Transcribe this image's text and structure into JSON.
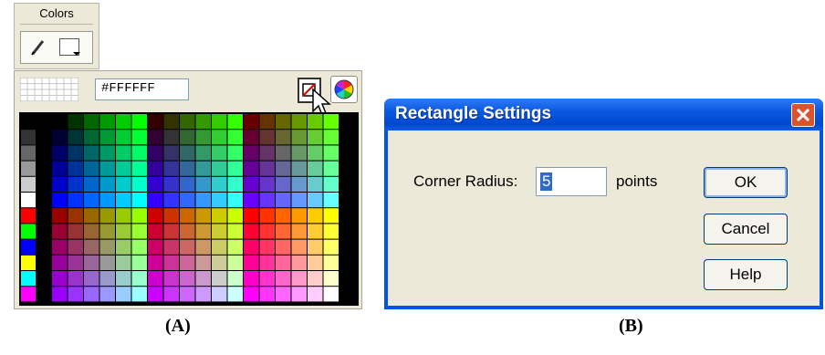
{
  "colors_panel": {
    "tab_title": "Colors",
    "hex_value": "#FFFFFF",
    "caption": "(A)"
  },
  "dialog": {
    "title": "Rectangle Settings",
    "corner_radius_label": "Corner Radius:",
    "corner_radius_value": "5",
    "units_label": "points",
    "ok_label": "OK",
    "cancel_label": "Cancel",
    "help_label": "Help",
    "caption": "(B)"
  },
  "colors": {
    "titlebar": "#0054e3",
    "client": "#ece9d8",
    "close": "#d9532c"
  }
}
